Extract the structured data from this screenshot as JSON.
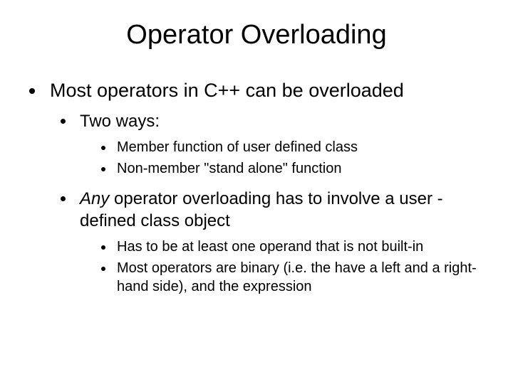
{
  "title": "Operator Overloading",
  "bullets": {
    "l1_a": "Most operators in C++ can be overloaded",
    "l2_a": "Two ways:",
    "l3_a": "Member function of user defined class",
    "l3_b": "Non-member \"stand alone\" function",
    "l2_b_italic": "Any",
    "l2_b_rest": " operator overloading has to involve a user -defined class object",
    "l3_c": "Has to be at least one operand that is not built-in",
    "l3_d": "Most operators are binary (i.e. the have a left and a right-hand side), and the expression"
  }
}
